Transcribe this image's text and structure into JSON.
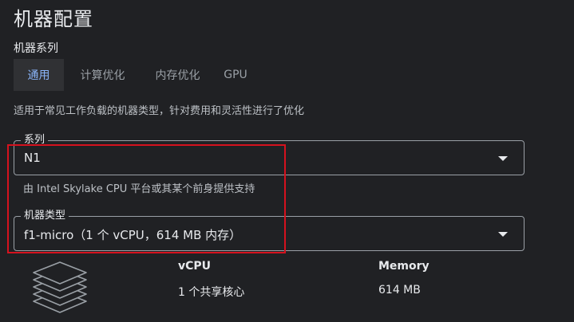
{
  "page": {
    "title": "机器配置"
  },
  "machine_family": {
    "label": "机器系列",
    "tabs": [
      {
        "label": "通用",
        "selected": true
      },
      {
        "label": "计算优化",
        "selected": false
      },
      {
        "label": "内存优化",
        "selected": false
      },
      {
        "label": "GPU",
        "selected": false
      }
    ],
    "description": "适用于常见工作负载的机器类型，针对费用和灵活性进行了优化"
  },
  "series_field": {
    "label": "系列",
    "value": "N1",
    "helper": "由 Intel Skylake CPU 平台或其某个前身提供支持",
    "icon": "chevron-down-icon"
  },
  "machine_type_field": {
    "label": "机器类型",
    "value": "f1-micro（1 个 vCPU，614 MB 内存）",
    "icon": "chevron-down-icon"
  },
  "specs": {
    "icon": "stack-layers-icon",
    "vcpu": {
      "label": "vCPU",
      "value": "1 个共享核心"
    },
    "memory": {
      "label": "Memory",
      "value": "614 MB"
    }
  },
  "colors": {
    "background": "#202124",
    "text": "#e8eaed",
    "active_tab_text": "#8ab4f8",
    "highlight": "#d5121e"
  }
}
